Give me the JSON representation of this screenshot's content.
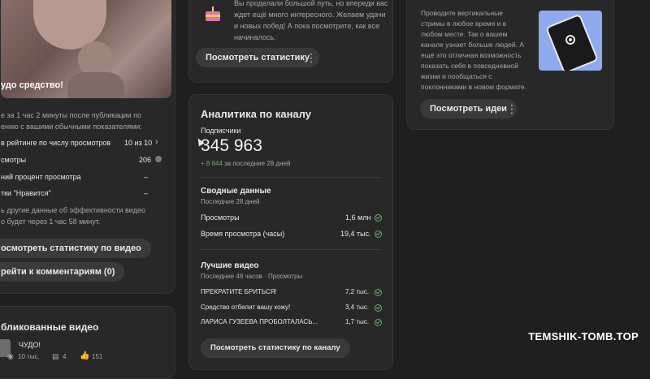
{
  "left_card": {
    "video_title_partial": "удо средство!",
    "desc_line1": "е за 1 час 2 минуты после публикации по",
    "desc_line2": "ению с вашими обычными показателями:",
    "rows": [
      {
        "label": "в рейтинге по числу просмотров",
        "value": "10 из 10"
      },
      {
        "label": "смотры",
        "value": "206"
      },
      {
        "label": "ний процент просмотра",
        "value": "–"
      },
      {
        "label": "тки \"Нравится\"",
        "value": "–"
      }
    ],
    "note_line1": "ь другие данные об эффективности видео",
    "note_line2": "о будет через 1 час 58 минут.",
    "btn_stats": "осмотреть статистику по видео",
    "btn_comments": "рейти к комментариям (0)"
  },
  "left_bottom": {
    "title": "бликованные видео",
    "video_title": "ЧУДО!",
    "views": "10 тыс.",
    "comments": "4",
    "likes": "151"
  },
  "mid_top": {
    "text_line1": "Вы проделали большой путь, но впереди вас",
    "text_line2": "ждет ещё много интересного. Желаем удачи",
    "text_line3": "и новых побед! А пока посмотрите, как все",
    "text_line4": "начиналось.",
    "btn": "Посмотреть статистику"
  },
  "analytics": {
    "title": "Аналитика по каналу",
    "subs_label": "Подписчики",
    "subs_value": "345 963",
    "subs_delta": "+ 8 844",
    "subs_delta_period": "за последние 28 дней",
    "summary_title": "Сводные данные",
    "summary_period": "Последние 28 дней",
    "metrics": [
      {
        "label": "Просмотры",
        "value": "1,6 млн"
      },
      {
        "label": "Время просмотра (часы)",
        "value": "19,4 тыс."
      }
    ],
    "top_title": "Лучшие видео",
    "top_period": "Последние 48 часов · Просмотры",
    "top_videos": [
      {
        "title": "ПРЕКРАТИТЕ БРИТЬСЯ!",
        "views": "7,2 тыс."
      },
      {
        "title": "Средство отбелит вашу кожу!",
        "views": "3,4 тыс."
      },
      {
        "title": "ЛАРИСА ГУЗЕЕВА ПРОБОЛТАЛАСЬ...",
        "views": "1,7 тыс."
      }
    ],
    "btn": "Посмотреть статистику по каналу"
  },
  "right_card": {
    "text_lines": [
      "Проводите вертикальные",
      "стримы в любое время и в",
      "любом месте. Так о вашем",
      "канале узнает больше людей. А",
      "ещё это отличная возможность",
      "показать себя в повседневной",
      "жизни и пообщаться с",
      "поклонниками в новом формате."
    ],
    "btn": "Посмотреть идеи"
  },
  "watermark": "TEMSHIK-TOMB.TOP",
  "colors": {
    "accent_green": "#6cae6c",
    "card_bg": "#282828",
    "page_bg": "#1f1f1f"
  }
}
